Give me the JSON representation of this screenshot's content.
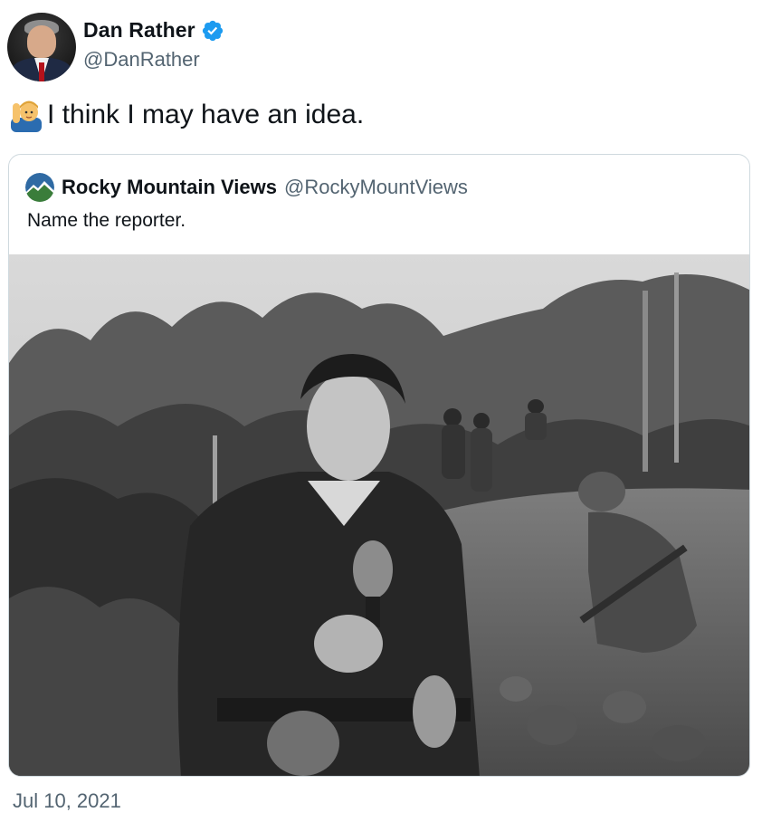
{
  "tweet": {
    "author_name": "Dan Rather",
    "author_handle": "@DanRather",
    "text": "I think I may have an idea.",
    "timestamp": "Jul 10, 2021"
  },
  "quote": {
    "author_name": "Rocky Mountain Views",
    "author_handle": "@RockyMountViews",
    "text": "Name the reporter."
  },
  "icons": {
    "verified": "verified-badge-icon",
    "emoji": "person-raising-hand-emoji"
  },
  "colors": {
    "verified_blue": "#1d9bf0",
    "secondary_text": "#536471",
    "border": "#cfd9de"
  }
}
